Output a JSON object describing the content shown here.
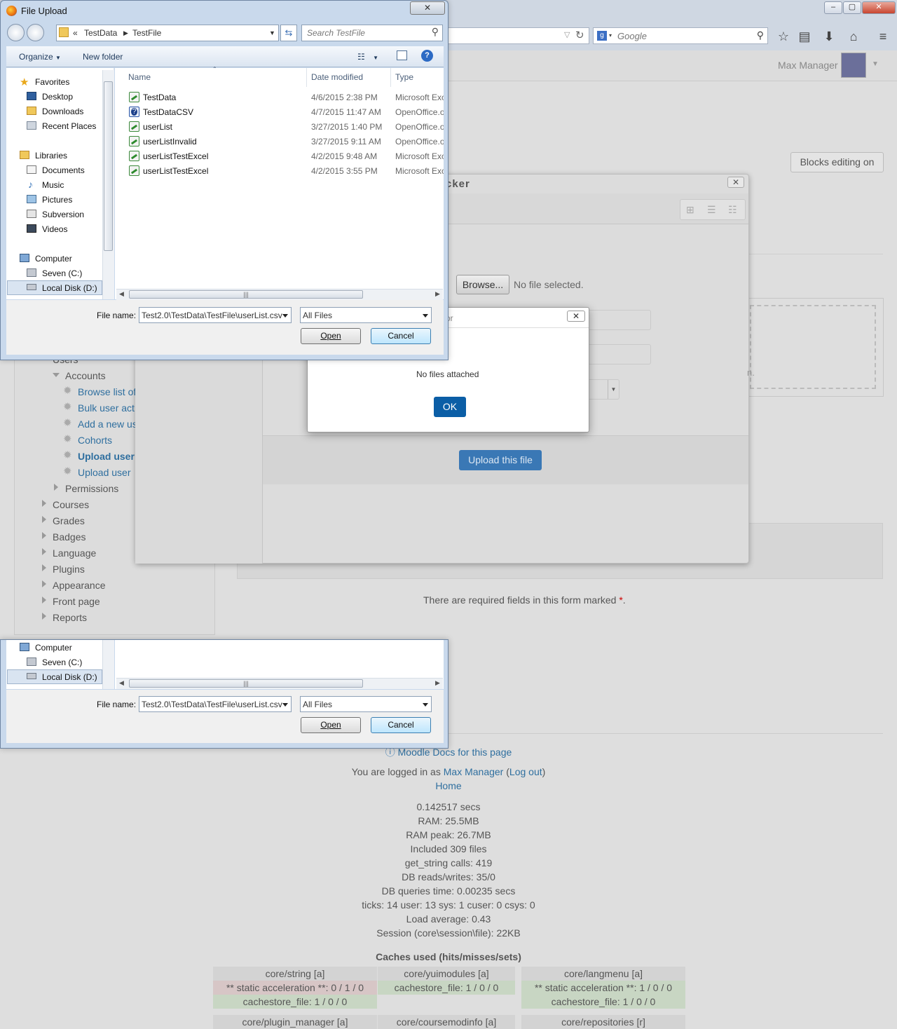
{
  "browser": {
    "search_placeholder": "Google",
    "win_buttons": [
      "–",
      "▢",
      "✕"
    ]
  },
  "page": {
    "user_name": "Max Manager",
    "blocks_button": "Blocks editing on",
    "nav": {
      "users_partial": "Users",
      "accounts": "Accounts",
      "account_items": [
        "Browse list of",
        "Bulk user act",
        "Add a new us",
        "Cohorts",
        "Upload user",
        "Upload user"
      ],
      "permissions": "Permissions",
      "sections": [
        "Courses",
        "Grades",
        "Badges",
        "Language",
        "Plugins",
        "Appearance",
        "Front page",
        "Reports"
      ]
    },
    "picker": {
      "title_partial": "cker",
      "browse_label": "Browse...",
      "no_file": "No file selected.",
      "partial_n": "n.",
      "upload_button": "Upload this file"
    },
    "alert": {
      "title_partial": "or",
      "close": "✕",
      "message": "No files attached",
      "ok": "OK"
    },
    "required_text": "There are required fields in this form marked",
    "required_star": "*",
    "required_end": "."
  },
  "footer": {
    "docs_link": "Moodle Docs for this page",
    "logged_in_prefix": "You are logged in as",
    "logged_user": "Max Manager",
    "logout": "Log out",
    "home": "Home",
    "stats": [
      "0.142517 secs",
      "RAM: 25.5MB",
      "RAM peak: 26.7MB",
      "Included 309 files",
      "get_string calls: 419",
      "DB reads/writes: 35/0",
      "DB queries time: 0.00235 secs",
      "ticks: 14 user: 13 sys: 1 cuser: 0 csys: 0",
      "Load average: 0.43",
      "Session (core\\session\\file): 22KB"
    ],
    "caches_title": "Caches used (hits/misses/sets)",
    "caches": [
      {
        "name": "core/string [a]",
        "rows": [
          "** static acceleration **: 0 / 1 / 0",
          "cachestore_file: 1 / 0 / 0"
        ]
      },
      {
        "name": "core/yuimodules [a]",
        "rows": [
          "cachestore_file: 1 / 0 / 0"
        ]
      },
      {
        "name": "core/langmenu [a]",
        "rows": [
          "** static acceleration **: 1 / 0 / 0",
          "cachestore_file: 1 / 0 / 0"
        ]
      }
    ],
    "caches_row2": [
      "core/plugin_manager [a]",
      "core/coursemodinfo [a]",
      "core/repositories [r]"
    ]
  },
  "dialog": {
    "title": "File Upload",
    "close": "✕",
    "breadcrumb": [
      "«",
      "TestData",
      "TestFile"
    ],
    "search_placeholder": "Search TestFile",
    "organize": "Organize",
    "new_folder": "New folder",
    "tree": {
      "favorites": "Favorites",
      "favorite_items": [
        "Desktop",
        "Downloads",
        "Recent Places"
      ],
      "libraries": "Libraries",
      "library_items": [
        "Documents",
        "Music",
        "Pictures",
        "Subversion",
        "Videos"
      ],
      "computer": "Computer",
      "computer_items": [
        "Seven (C:)",
        "Local Disk (D:)"
      ]
    },
    "columns": [
      "Name",
      "Date modified",
      "Type"
    ],
    "files": [
      {
        "name": "TestData",
        "date": "4/6/2015 2:38 PM",
        "type": "Microsoft Exc"
      },
      {
        "name": "TestDataCSV",
        "date": "4/7/2015 11:47 AM",
        "type": "OpenOffice.o"
      },
      {
        "name": "userList",
        "date": "3/27/2015 1:40 PM",
        "type": "OpenOffice.o"
      },
      {
        "name": "userListInvalid",
        "date": "3/27/2015 9:11 AM",
        "type": "OpenOffice.o"
      },
      {
        "name": "userListTestExcel",
        "date": "4/2/2015 9:48 AM",
        "type": "Microsoft Exc"
      },
      {
        "name": "userListTestExcel",
        "date": "4/2/2015 3:55 PM",
        "type": "Microsoft Exc"
      }
    ],
    "file_name_label": "File name:",
    "file_name_value": "Test2.0\\TestData\\TestFile\\userList.csv",
    "file_type": "All Files",
    "open": "Open",
    "cancel": "Cancel"
  }
}
